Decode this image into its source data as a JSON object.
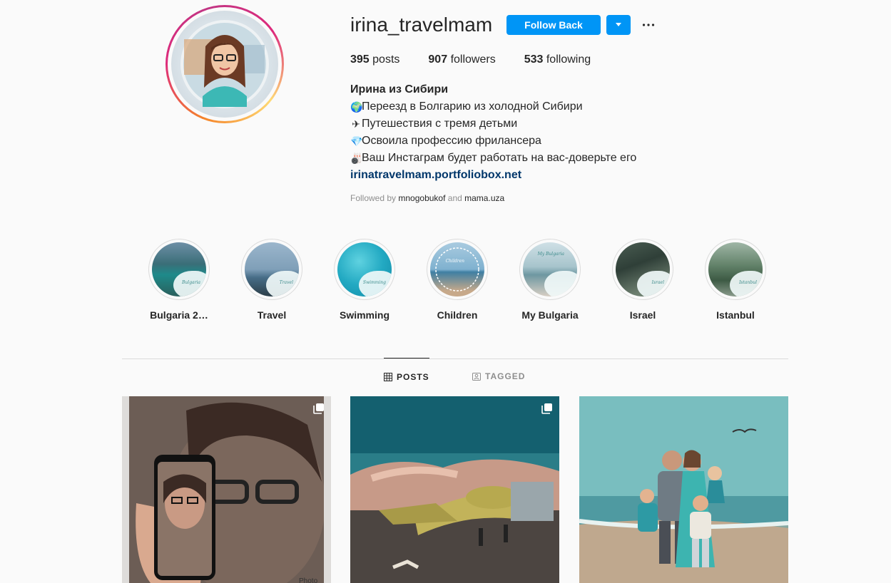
{
  "profile": {
    "username": "irina_travelmam",
    "follow_label": "Follow Back",
    "stats": [
      {
        "count": "395",
        "label": "posts"
      },
      {
        "count": "907",
        "label": "followers"
      },
      {
        "count": "533",
        "label": "following"
      }
    ],
    "bio": {
      "name": "Ирина из Сибири",
      "lines": [
        {
          "emoji": "🌍",
          "text": "Переезд в Болгарию из холодной Сибири"
        },
        {
          "emoji": "✈",
          "text": "Путешествия с тремя детьми"
        },
        {
          "emoji": "💎",
          "text": "Освоила профессию фрилансера"
        },
        {
          "emoji": "🎳",
          "text": "Ваш Инстаграм будет работать на вас-доверьте его"
        }
      ],
      "link": "irinatravelmam.portfoliobox.net"
    },
    "followed_by": {
      "prefix": "Followed by",
      "user1": "mnogobukof",
      "conj": "and",
      "user2": "mama.uza"
    }
  },
  "highlights": [
    {
      "label": "Bulgaria 2…",
      "tag": "Bulgaria"
    },
    {
      "label": "Travel",
      "tag": "Travel"
    },
    {
      "label": "Swimming",
      "tag": "Swimming"
    },
    {
      "label": "Children",
      "tag": "Children"
    },
    {
      "label": "My Bulgaria",
      "tag": "My Bulgaria"
    },
    {
      "label": "Israel",
      "tag": "Israel"
    },
    {
      "label": "Istanbul",
      "tag": "Istanbul"
    }
  ],
  "tabs": {
    "posts": "POSTS",
    "tagged": "TAGGED"
  },
  "posts": [
    {
      "description": "woman holding phone",
      "multi": true,
      "caption": "Photo"
    },
    {
      "description": "airplane at airport",
      "multi": true
    },
    {
      "description": "family on beach",
      "multi": false
    }
  ],
  "colors": {
    "accent": "#0095f6",
    "link": "#00376b",
    "muted": "#8e8e8e",
    "text": "#262626"
  }
}
